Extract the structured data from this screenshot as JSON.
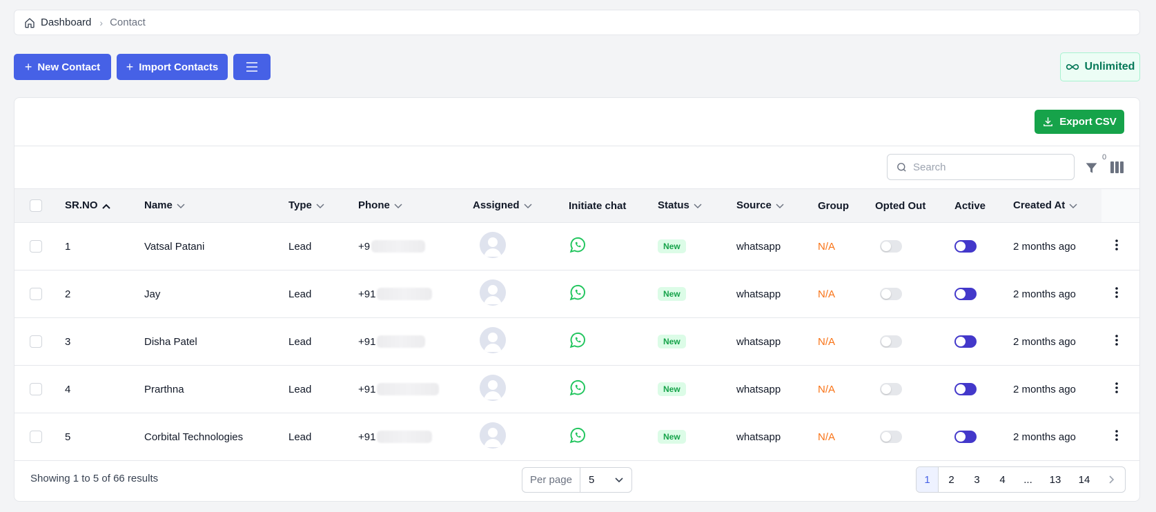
{
  "breadcrumb": {
    "home": "Dashboard",
    "current": "Contact"
  },
  "toolbar": {
    "new_contact": "New Contact",
    "import_contacts": "Import Contacts",
    "plan": "Unlimited"
  },
  "card": {
    "export": "Export CSV",
    "search_placeholder": "Search",
    "filter_count": "0"
  },
  "table": {
    "columns": [
      "SR.NO",
      "Name",
      "Type",
      "Phone",
      "Assigned",
      "Initiate chat",
      "Status",
      "Source",
      "Group",
      "Opted Out",
      "Active",
      "Created At"
    ],
    "rows": [
      {
        "sr": "1",
        "name": "Vatsal Patani",
        "type": "Lead",
        "phone": "+9",
        "status": "New",
        "source": "whatsapp",
        "group": "N/A",
        "created": "2 months ago"
      },
      {
        "sr": "2",
        "name": "Jay",
        "type": "Lead",
        "phone": "+91",
        "status": "New",
        "source": "whatsapp",
        "group": "N/A",
        "created": "2 months ago"
      },
      {
        "sr": "3",
        "name": "Disha Patel",
        "type": "Lead",
        "phone": "+91",
        "status": "New",
        "source": "whatsapp",
        "group": "N/A",
        "created": "2 months ago"
      },
      {
        "sr": "4",
        "name": "Prarthna",
        "type": "Lead",
        "phone": "+91",
        "status": "New",
        "source": "whatsapp",
        "group": "N/A",
        "created": "2 months ago"
      },
      {
        "sr": "5",
        "name": "Corbital Technologies",
        "type": "Lead",
        "phone": "+91",
        "status": "New",
        "source": "whatsapp",
        "group": "N/A",
        "created": "2 months ago"
      }
    ]
  },
  "footer": {
    "showing": "Showing 1 to 5 of 66 results",
    "per_page_label": "Per page",
    "per_page_value": "5",
    "pages": [
      "1",
      "2",
      "3",
      "4",
      "...",
      "13",
      "14"
    ]
  },
  "colors": {
    "primary": "#4661e6",
    "export": "#16a34a",
    "whatsapp": "#22c55e",
    "na": "#f97316",
    "active_toggle": "#4338ca"
  }
}
